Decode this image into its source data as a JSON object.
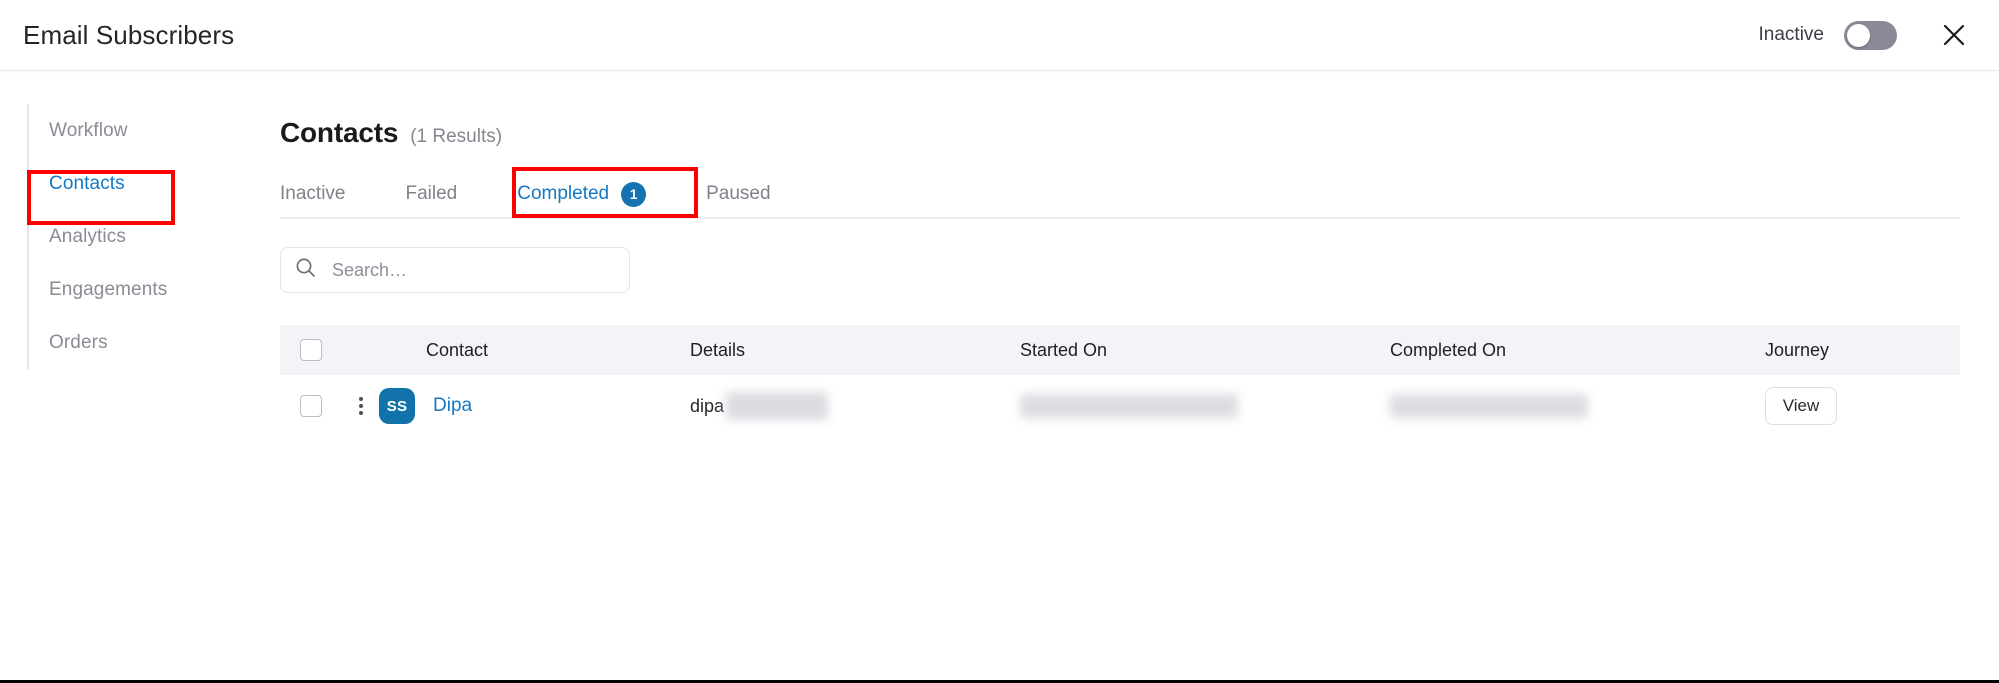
{
  "header": {
    "title": "Email Subscribers",
    "status_label": "Inactive",
    "toggle_state": "off",
    "close_icon": "close-icon"
  },
  "sidebar": {
    "items": [
      {
        "label": "Workflow",
        "active": false
      },
      {
        "label": "Contacts",
        "active": true
      },
      {
        "label": "Analytics",
        "active": false
      },
      {
        "label": "Engagements",
        "active": false
      },
      {
        "label": "Orders",
        "active": false
      }
    ]
  },
  "main": {
    "heading": "Contacts",
    "result_count": "(1 Results)",
    "tabs": [
      {
        "label": "Inactive",
        "badge": "",
        "active": false
      },
      {
        "label": "Failed",
        "badge": "",
        "active": false
      },
      {
        "label": "Completed",
        "badge": "1",
        "active": true
      },
      {
        "label": "Paused",
        "badge": "",
        "active": false
      }
    ],
    "search": {
      "value": "",
      "placeholder": "Search…",
      "icon": "search-icon"
    },
    "table": {
      "columns": [
        "Contact",
        "Details",
        "Started On",
        "Completed On",
        "Journey"
      ],
      "rows": [
        {
          "avatar_initials": "SS",
          "contact": "Dipa",
          "details": "dipa",
          "details_redacted": true,
          "started_on": "",
          "started_on_redacted": true,
          "completed_on": "",
          "completed_on_redacted": true,
          "journey_action": "View"
        }
      ]
    }
  },
  "annotations": {
    "contacts_box": "red-highlight-contacts",
    "completed_box": "red-highlight-completed"
  },
  "colors": {
    "accent_blue": "#1479c4",
    "badge_blue": "#1473b0",
    "avatar_blue": "#1273ab",
    "annotation_red": "#ff0000",
    "table_header_bg": "#f3f4f8"
  }
}
